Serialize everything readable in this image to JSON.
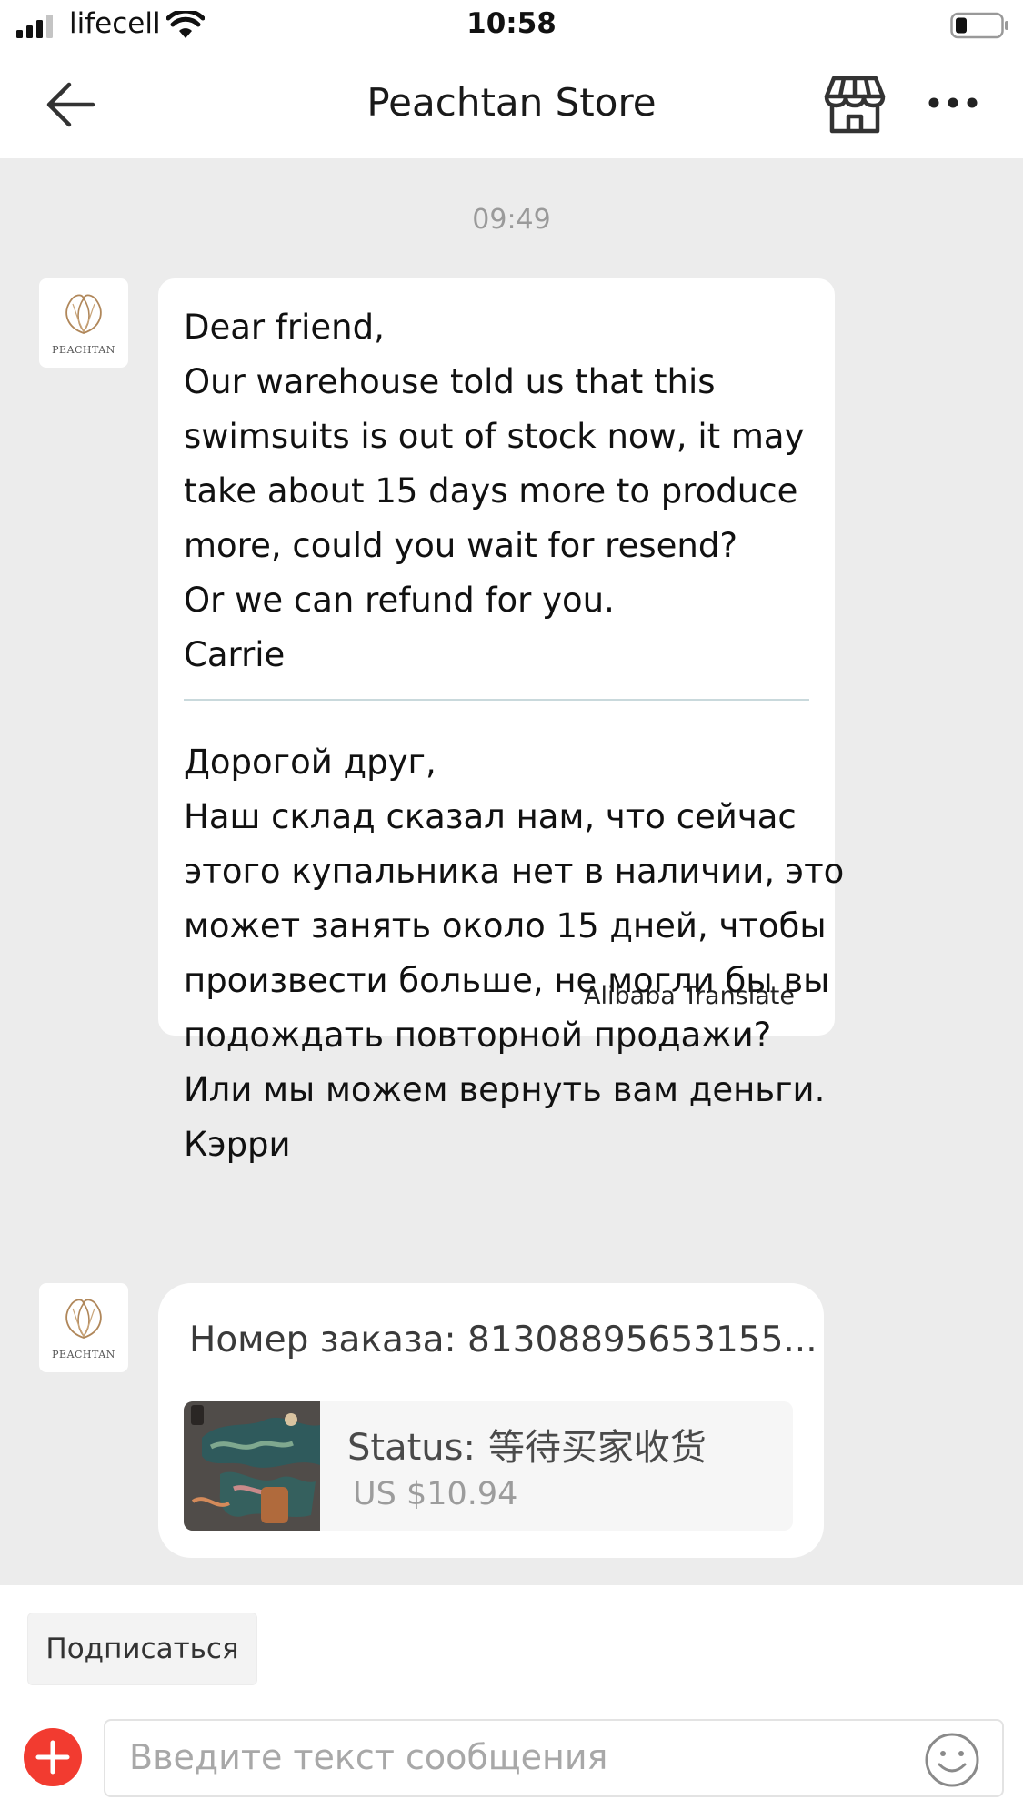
{
  "status_bar": {
    "carrier": "lifecell",
    "time": "10:58"
  },
  "nav": {
    "title": "Peachtan Store",
    "icons": [
      "back-arrow-icon",
      "store-icon",
      "more-icon"
    ]
  },
  "chat": {
    "timestamp": "09:49",
    "avatar_text": "PEACHTAN",
    "message": {
      "original_lines": [
        "Dear friend,",
        "Our warehouse told us that this",
        "swimsuits is out of stock now, it may",
        "take about 15 days more to produce",
        "more, could you wait for resend?",
        "Or we can refund for you.",
        "Carrie"
      ],
      "translated_lines": [
        "Дорогой друг,",
        "Наш склад сказал нам, что сейчас",
        "этого купальника нет в наличии, это",
        "может занять около 15 дней, чтобы",
        "произвести больше, не могли бы вы",
        "подождать повторной продажи?",
        "Или мы можем вернуть вам деньги.",
        "Кэрри"
      ],
      "translate_credit": "Alibaba Translate"
    },
    "order": {
      "number_label": "Номер заказа: 81308895653155...",
      "status_label": "Status:",
      "status_value": "等待买家收货",
      "price": "US $10.94"
    }
  },
  "bottom": {
    "subscribe_label": "Подписаться",
    "input_placeholder": "Введите текст сообщения"
  },
  "colors": {
    "chat_background": "#ececec",
    "add_button": "#f23b30",
    "divider": "#c9d9dc"
  }
}
